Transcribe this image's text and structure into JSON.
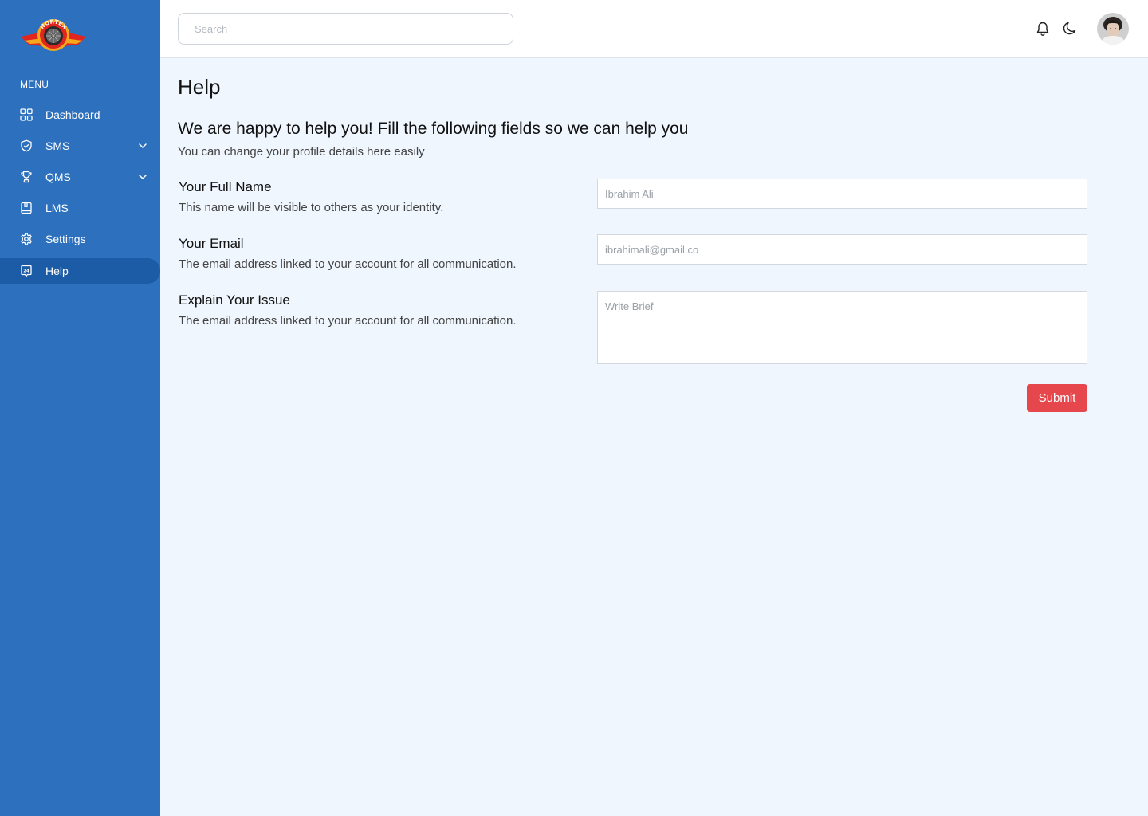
{
  "brand": {
    "logo_text": "NORTEX"
  },
  "sidebar": {
    "menu_heading": "MENU",
    "items": [
      {
        "label": "Dashboard",
        "icon": "grid-icon"
      },
      {
        "label": "SMS",
        "icon": "shield-check-icon",
        "has_submenu": true
      },
      {
        "label": "QMS",
        "icon": "trophy-icon",
        "has_submenu": true
      },
      {
        "label": "LMS",
        "icon": "book-icon"
      },
      {
        "label": "Settings",
        "icon": "gear-icon"
      },
      {
        "label": "Help",
        "icon": "support-24-icon",
        "active": true
      }
    ]
  },
  "header": {
    "search_placeholder": "Search",
    "icons": [
      "bell-icon",
      "moon-icon"
    ]
  },
  "main": {
    "title": "Help",
    "heading": "We are happy to help you! Fill the following fields so we can help you",
    "subheading": "You can change your profile details here easily",
    "fields": [
      {
        "label": "Your Full Name",
        "help": "This name will be visible to others as your identity.",
        "placeholder": "Ibrahim Ali"
      },
      {
        "label": "Your Email",
        "help": "The email address linked to your account for all communication.",
        "placeholder": "ibrahimali@gmail.co"
      },
      {
        "label": "Explain Your Issue",
        "help": "The email address linked to your account for all communication.",
        "placeholder": "Write Brief"
      }
    ],
    "submit_label": "Submit"
  },
  "colors": {
    "sidebar_bg": "#2d70be",
    "active_item_bg": "#1c5ba5",
    "content_bg": "#eff6fe",
    "submit_bg": "#e5474c"
  }
}
